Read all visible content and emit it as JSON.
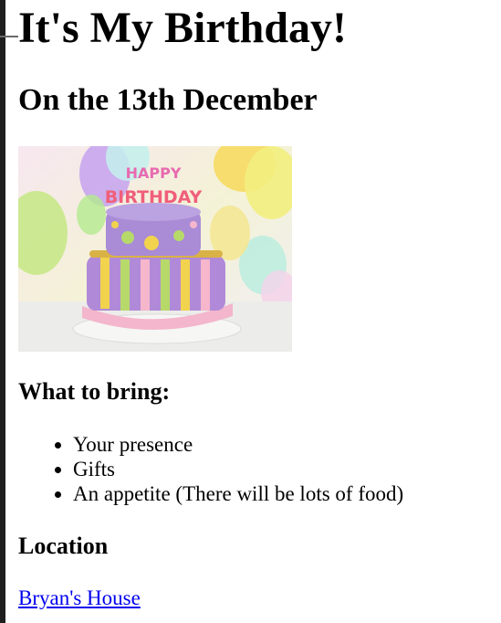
{
  "page": {
    "title": "It's My Birthday!",
    "date_heading": "On the 13th December"
  },
  "image": {
    "name": "birthday-cake-photo",
    "cake_topper_text": "HAPPY BIRTHDAY"
  },
  "bring": {
    "heading": "What to bring:",
    "items": [
      "Your presence",
      "Gifts",
      "An appetite (There will be lots of food)"
    ]
  },
  "location": {
    "heading": "Location",
    "link_text": "Bryan's House"
  },
  "colors": {
    "link": "#0000ee",
    "text": "#000000",
    "background": "#ffffff"
  }
}
